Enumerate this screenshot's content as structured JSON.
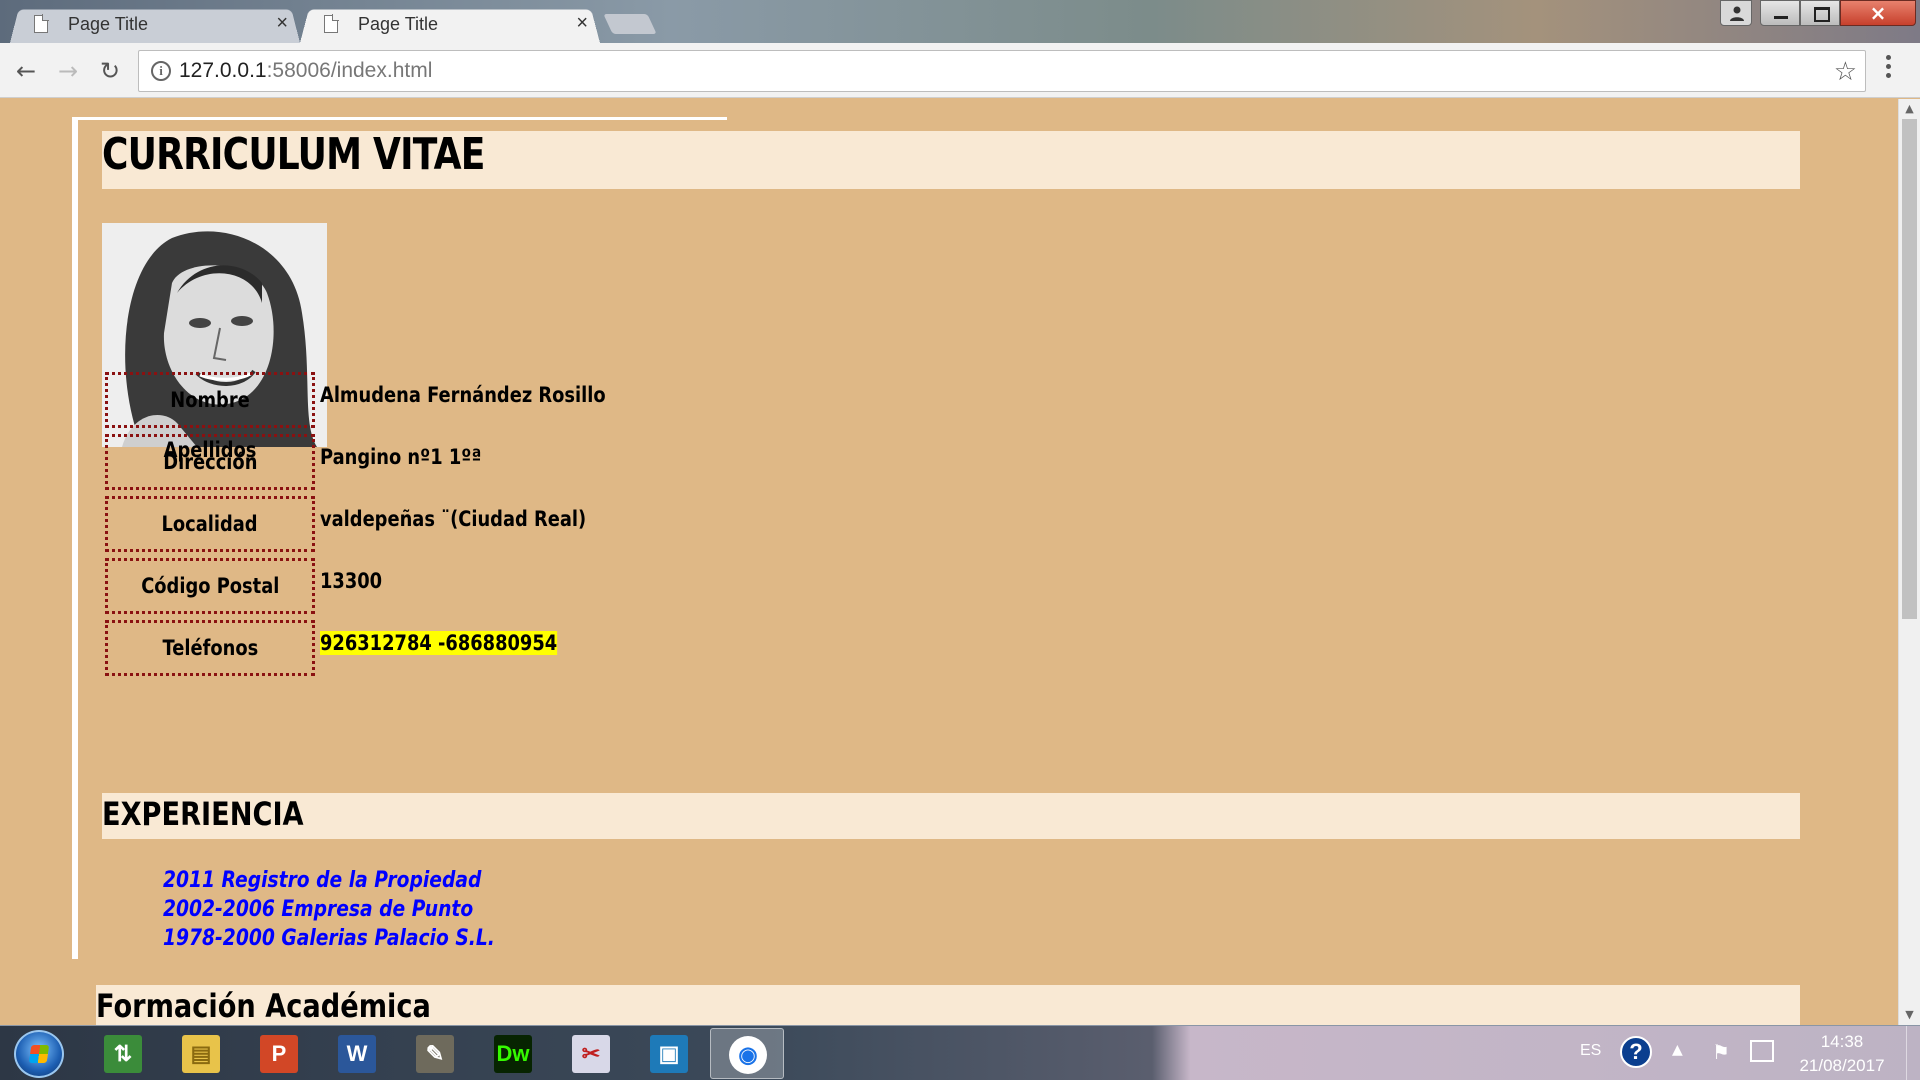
{
  "browser": {
    "tabs": [
      {
        "label": "Page Title",
        "active": false
      },
      {
        "label": "Page Title",
        "active": true
      }
    ],
    "close_glyph": "×",
    "address": {
      "host": "127.0.0.1",
      "rest": ":58006/index.html"
    },
    "nav": {
      "back": "←",
      "forward": "→",
      "reload": "↻"
    },
    "star": "☆",
    "info": "i"
  },
  "cv": {
    "title": "CURRICULUM VITAE",
    "details": [
      {
        "label": "Nombre Apellidos",
        "value": "Almudena Fernández Rosillo",
        "highlight": false
      },
      {
        "label": "Dirección",
        "value": "Pangino nº1 1ºª",
        "highlight": false
      },
      {
        "label": "Localidad",
        "value": "valdepeñas ¨(Ciudad Real)",
        "highlight": false
      },
      {
        "label": "Código Postal",
        "value": "13300",
        "highlight": false
      },
      {
        "label": "Teléfonos",
        "value": "926312784 -686880954",
        "highlight": true
      }
    ],
    "experience_heading": "EXPERIENCIA",
    "experience": [
      "2011 Registro de la Propiedad",
      "2002-2006 Empresa de Punto",
      "1978-2000 Galerias Palacio S.L."
    ],
    "education_heading": "Formación Académica"
  },
  "taskbar": {
    "lang": "ES",
    "help": "?",
    "time": "14:38",
    "date": "21/08/2017",
    "apps": [
      {
        "name": "control-panel",
        "glyph": "⇅",
        "bg": "#3b8c3a",
        "fg": "#fff"
      },
      {
        "name": "file-explorer",
        "glyph": "▤",
        "bg": "#e8c34a",
        "fg": "#8a6a10"
      },
      {
        "name": "powerpoint",
        "glyph": "P",
        "bg": "#d24726",
        "fg": "#fff"
      },
      {
        "name": "word",
        "glyph": "W",
        "bg": "#2b579a",
        "fg": "#fff"
      },
      {
        "name": "gimp",
        "glyph": "✎",
        "bg": "#6e6a5c",
        "fg": "#fff"
      },
      {
        "name": "dreamweaver",
        "glyph": "Dw",
        "bg": "#072401",
        "fg": "#35fa00"
      },
      {
        "name": "snipping-tool",
        "glyph": "✂",
        "bg": "#d8d8e8",
        "fg": "#c02020"
      },
      {
        "name": "remote-app",
        "glyph": "▣",
        "bg": "#1e7ab8",
        "fg": "#fff"
      },
      {
        "name": "chrome",
        "glyph": "◉",
        "bg": "#ffffff",
        "fg": "#1a73e8"
      }
    ]
  }
}
